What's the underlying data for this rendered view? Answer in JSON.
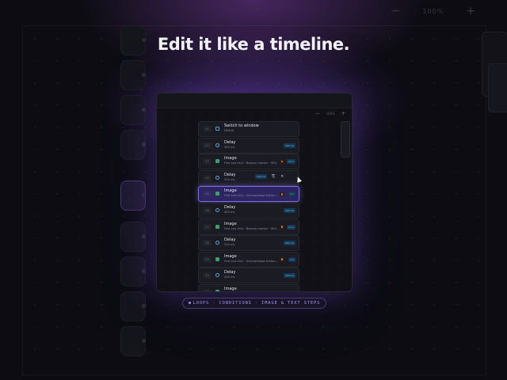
{
  "headline": "Edit it like a timeline.",
  "caption": "LOOPS · CONDITIONS · IMAGE & TEXT STEPS",
  "background_toolbar": {
    "minus": "−",
    "zoom": "100%",
    "plus": "+"
  },
  "window_toolbar": {
    "minus": "−",
    "zoom": "100%",
    "plus": "+"
  },
  "steps": [
    {
      "num": "01",
      "icon": "window-icon",
      "title": "Switch to window",
      "subtitle": "NEXUS",
      "badge": ""
    },
    {
      "num": "02",
      "icon": "clock-icon",
      "title": "Delay",
      "subtitle": "300 ms",
      "badge": "300 ms"
    },
    {
      "num": "03",
      "icon": "image-icon",
      "title": "Image",
      "subtitle": "Find and click · Beacon marker · 90%",
      "badge": "0.5 s"
    },
    {
      "num": "04",
      "icon": "clock-icon",
      "title": "Delay",
      "subtitle": "200 ms",
      "badge": "200 ms"
    },
    {
      "num": "05",
      "icon": "image-icon",
      "title": "Image",
      "subtitle": "Find and click · Acknowledge button...",
      "badge": "0.5"
    },
    {
      "num": "06",
      "icon": "clock-icon",
      "title": "Delay",
      "subtitle": "400 ms",
      "badge": "400 ms"
    },
    {
      "num": "07",
      "icon": "image-icon",
      "title": "Image",
      "subtitle": "Find and click · Beacon marker · 90%",
      "badge": "0.5 s"
    },
    {
      "num": "08",
      "icon": "clock-icon",
      "title": "Delay",
      "subtitle": "200 ms",
      "badge": "200 ms"
    },
    {
      "num": "09",
      "icon": "image-icon",
      "title": "Image",
      "subtitle": "Find and click · Acknowledge button...",
      "badge": "0.5"
    },
    {
      "num": "10",
      "icon": "clock-icon",
      "title": "Delay",
      "subtitle": "400 ms",
      "badge": "400 ms"
    },
    {
      "num": "11",
      "icon": "image-icon",
      "title": "Image",
      "subtitle": "",
      "badge": ""
    }
  ],
  "selected_step": 5,
  "hovered_step": 4,
  "colors": {
    "accent": "#7b6ce8",
    "background": "#0c0c12",
    "card": "#1b1b23"
  }
}
